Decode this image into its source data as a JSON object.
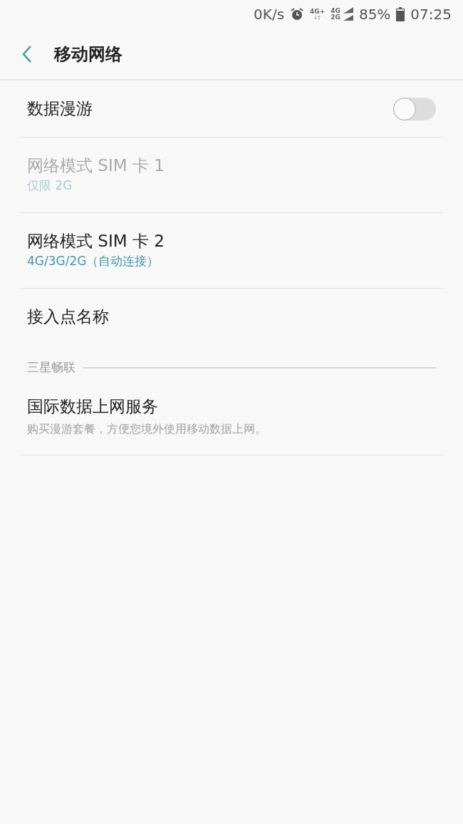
{
  "status_bar": {
    "speed": "0K/s",
    "sim1_network": "4G+",
    "sim2_network_top": "4G",
    "sim2_network_bottom": "2G",
    "battery": "85%",
    "time": "07:25"
  },
  "app_bar": {
    "title": "移动网络"
  },
  "sections": [
    {
      "items": [
        {
          "kind": "switch",
          "title": "数据漫游",
          "on": false,
          "disabled": false
        },
        {
          "kind": "setting",
          "title": "网络模式 SIM 卡 1",
          "summary": "仅限 2G",
          "disabled": true
        },
        {
          "kind": "setting",
          "title": "网络模式 SIM 卡 2",
          "summary": "4G/3G/2G（自动连接）",
          "disabled": false
        },
        {
          "kind": "setting",
          "title": "接入点名称",
          "disabled": false
        }
      ]
    },
    {
      "header": "三星畅联",
      "items": [
        {
          "kind": "setting",
          "title": "国际数据上网服务",
          "description": "购买漫游套餐，方便您境外使用移动数据上网。",
          "disabled": false
        }
      ]
    }
  ]
}
